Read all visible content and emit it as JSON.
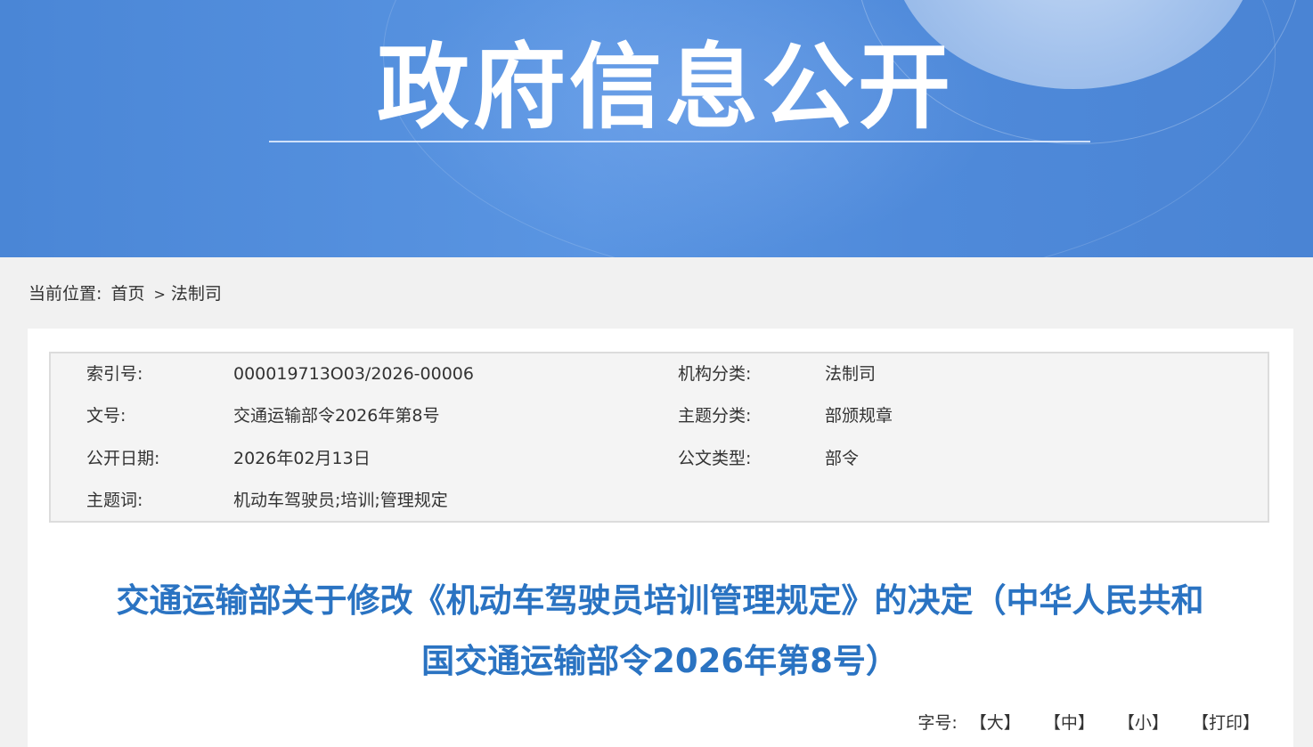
{
  "banner": {
    "title": "政府信息公开"
  },
  "breadcrumb": {
    "label": "当前位置:",
    "items": [
      "首页",
      "法制司"
    ],
    "separator": ">"
  },
  "meta": {
    "rows": [
      {
        "label": "索引号:",
        "value": "000019713O03/2026-00006",
        "label2": "机构分类:",
        "value2": "法制司"
      },
      {
        "label": "文号:",
        "value": "交通运输部令2026年第8号",
        "label2": "主题分类:",
        "value2": "部颁规章"
      },
      {
        "label": "公开日期:",
        "value": "2026年02月13日",
        "label2": "公文类型:",
        "value2": "部令"
      },
      {
        "label": "主题词:",
        "value": "机动车驾驶员;培训;管理规定"
      }
    ]
  },
  "document": {
    "title_line1": "交通运输部关于修改《机动车驾驶员培训管理规定》的决定（中华人民共和",
    "title_line2": "国交通运输部令2026年第8号）"
  },
  "font_size": {
    "label": "字号:",
    "large": "【大】",
    "medium": "【中】",
    "small": "【小】",
    "print": "【打印】"
  },
  "colors": {
    "banner": "#4f8ada",
    "title": "#2a73c2"
  }
}
